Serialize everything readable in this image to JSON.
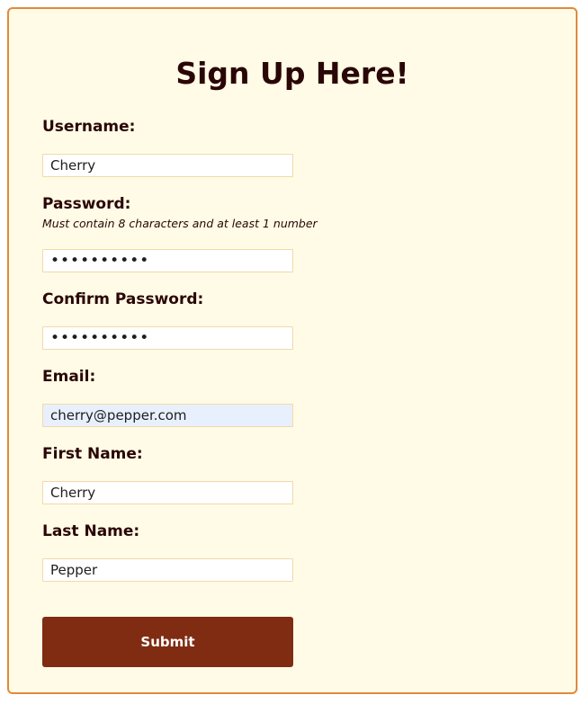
{
  "form": {
    "title": "Sign Up Here!",
    "username": {
      "label": "Username:",
      "value": "Cherry"
    },
    "password": {
      "label": "Password:",
      "hint": "Must contain 8 characters and at least 1 number",
      "value": "••••••••••"
    },
    "confirm_password": {
      "label": "Confirm Password:",
      "value": "••••••••••"
    },
    "email": {
      "label": "Email:",
      "value": "cherry@pepper.com"
    },
    "first_name": {
      "label": "First Name:",
      "value": "Cherry"
    },
    "last_name": {
      "label": "Last Name:",
      "value": "Pepper"
    },
    "submit_label": "Submit"
  },
  "colors": {
    "card_background": "#fffbe6",
    "card_border": "#e08a3a",
    "text": "#2a0606",
    "button": "#7f2c12",
    "input_border": "#f2d9a8",
    "autofill_background": "#e8f0fe"
  }
}
